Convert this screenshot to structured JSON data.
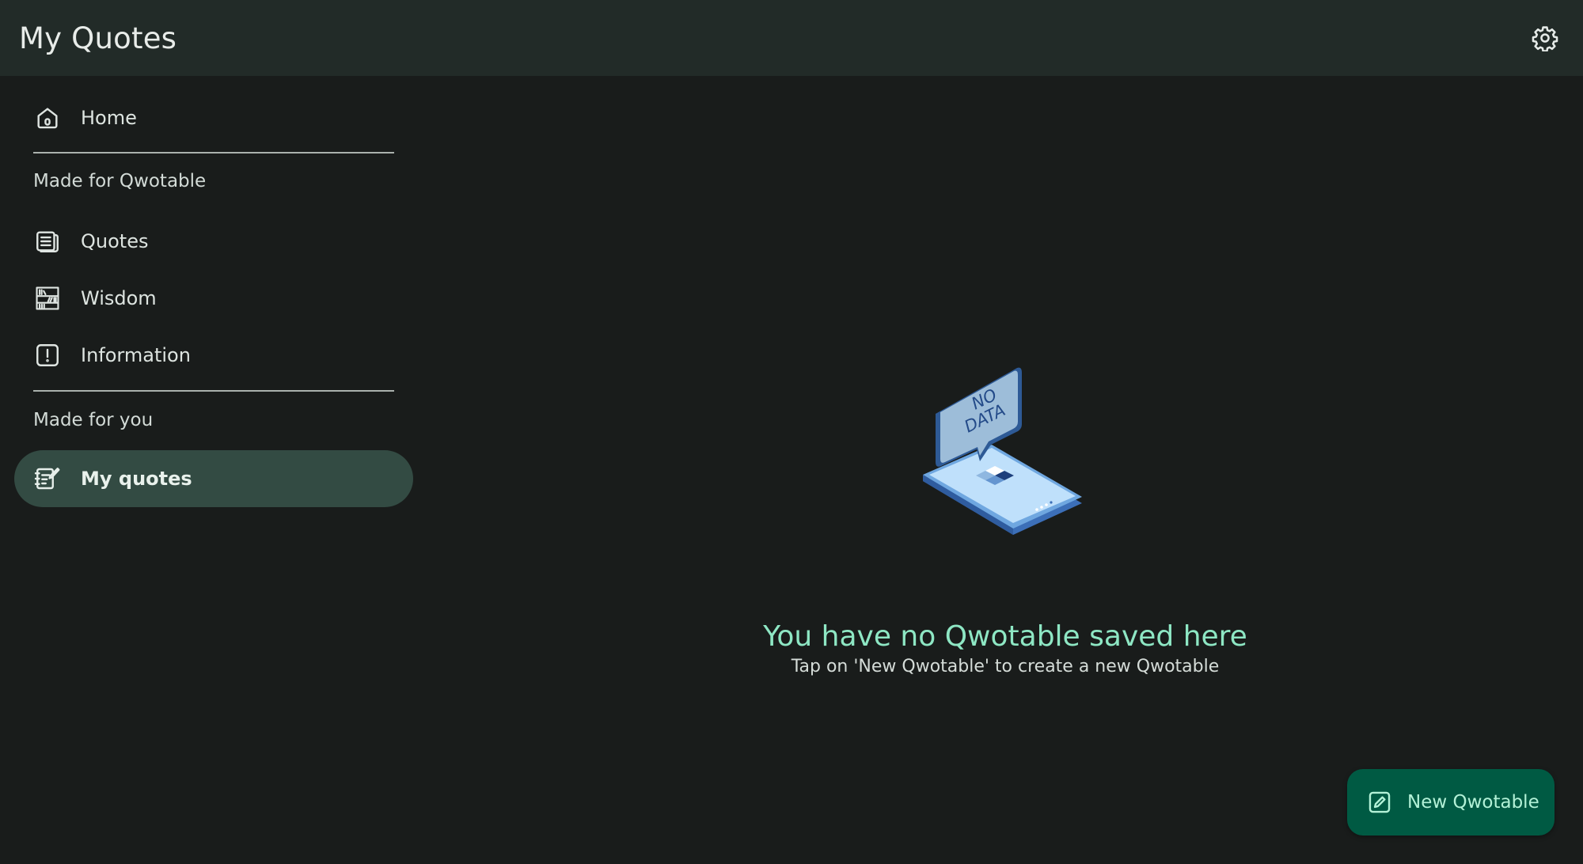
{
  "app_bar": {
    "title": "My Quotes",
    "settings_icon": "gear-icon"
  },
  "sidebar": {
    "home": {
      "label": "Home",
      "icon": "home-icon"
    },
    "section_qwotable": "Made for Qwotable",
    "qwotable_items": [
      {
        "label": "Quotes",
        "icon": "article-icon"
      },
      {
        "label": "Wisdom",
        "icon": "bookshelf-icon"
      },
      {
        "label": "Information",
        "icon": "info-alert-icon"
      }
    ],
    "section_you": "Made for you",
    "you_items": [
      {
        "label": "My quotes",
        "icon": "edit-note-icon",
        "active": true
      }
    ]
  },
  "empty_state": {
    "illustration_text_line1": "NO",
    "illustration_text_line2": "DATA",
    "title": "You have no Qwotable saved here",
    "subtitle": "Tap on 'New Qwotable' to create a new Qwotable"
  },
  "fab": {
    "label": "New Qwotable",
    "icon": "edit-square-icon"
  },
  "colors": {
    "background": "#191c1b",
    "app_bar": "#222b28",
    "active_nav": "#334b43",
    "accent_text": "#8ee7c4",
    "fab": "#005a43"
  }
}
